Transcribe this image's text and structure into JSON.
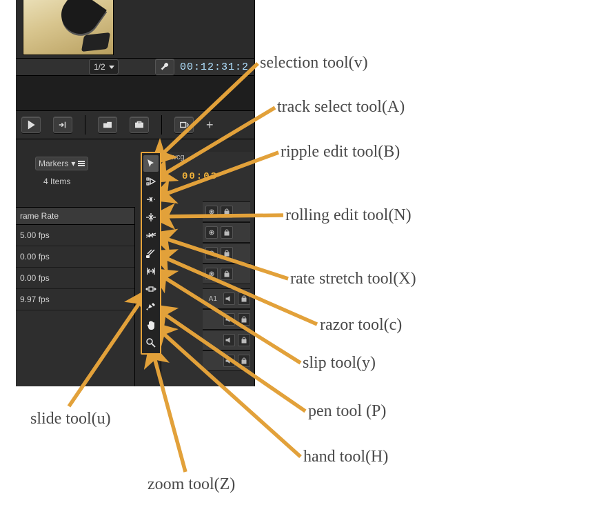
{
  "preview": {
    "res_label": "1/2",
    "timecode": "00:12:31:2"
  },
  "markers_panel": {
    "tab_label": "Markers",
    "items_label": "4 Items"
  },
  "frame_rate_header": "rame Rate",
  "frame_rates": [
    "5.00 fps",
    "0.00 fps",
    "0.00 fps",
    "9.97 fps"
  ],
  "timeline": {
    "sequence_tab": "wcg",
    "timecode": "00:03",
    "audio_track_label": "A1"
  },
  "tools": [
    {
      "id": "selection",
      "label": "selection tool(v)"
    },
    {
      "id": "track-select",
      "label": "track select tool(A)"
    },
    {
      "id": "ripple-edit",
      "label": "ripple edit tool(B)"
    },
    {
      "id": "rolling-edit",
      "label": "rolling edit tool(N)"
    },
    {
      "id": "rate-stretch",
      "label": "rate stretch tool(X)"
    },
    {
      "id": "razor",
      "label": "razor tool(c)"
    },
    {
      "id": "slip",
      "label": "slip tool(y)"
    },
    {
      "id": "slide",
      "label": "slide tool(u)"
    },
    {
      "id": "pen",
      "label": "pen tool (P)"
    },
    {
      "id": "hand",
      "label": "hand tool(H)"
    },
    {
      "id": "zoom",
      "label": "zoom tool(Z)"
    }
  ]
}
